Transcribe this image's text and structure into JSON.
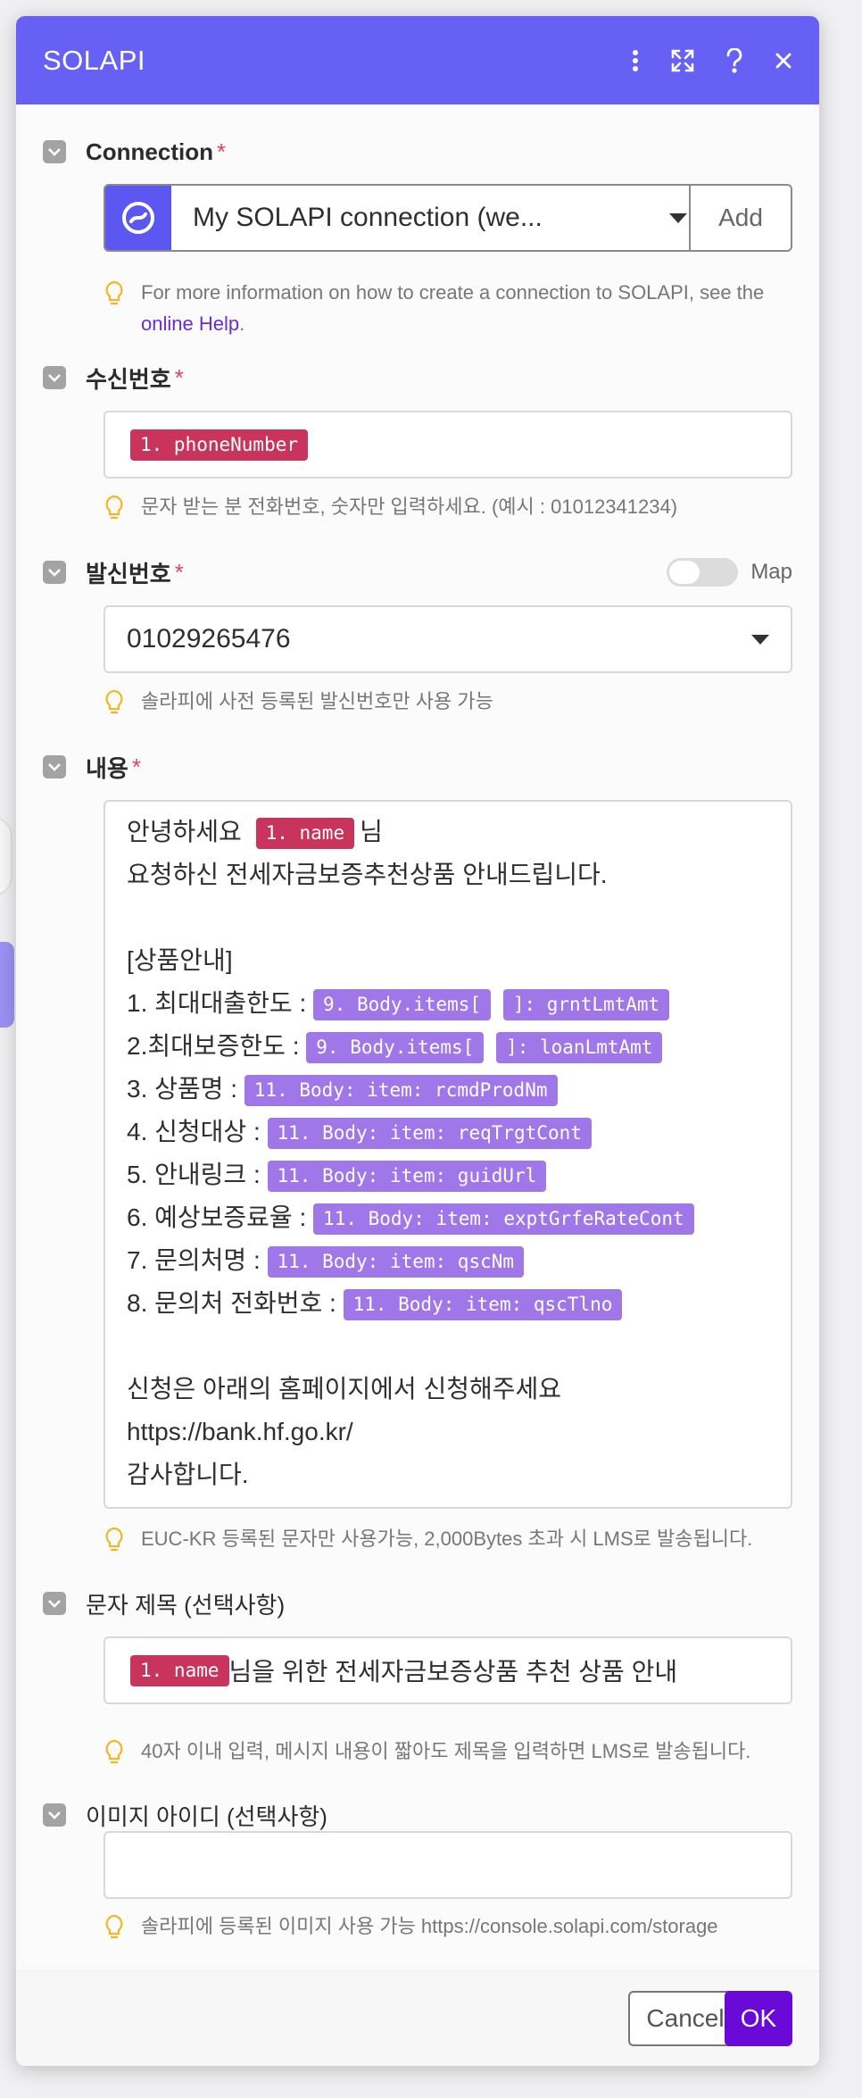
{
  "header": {
    "title": "SOLAPI"
  },
  "connection": {
    "label": "Connection",
    "required": "*",
    "selected": "My SOLAPI connection (we...",
    "add_label": "Add",
    "hint_prefix": "For more information on how to create a connection to SOLAPI, see the ",
    "hint_link": "online Help",
    "hint_suffix": "."
  },
  "recipient": {
    "label": "수신번호",
    "required": "*",
    "tag": "1. phoneNumber",
    "hint": "문자 받는 분 전화번호, 숫자만 입력하세요. (예시 : 01012341234)"
  },
  "sender": {
    "label": "발신번호",
    "required": "*",
    "map_label": "Map",
    "selected": "01029265476",
    "hint": "솔라피에 사전 등록된 발신번호만 사용 가능"
  },
  "content": {
    "label": "내용",
    "required": "*",
    "line1_text": "안녕하세요",
    "line1_tag": "1. name",
    "line1_suffix": "님",
    "line2": "요청하신 전세자금보증추천상품 안내드립니다.",
    "line3": "[상품안내]",
    "item1_label": " 1. 최대대출한도 :",
    "item1_tag_a": "9. Body.items[",
    "item1_tag_b": "]: grntLmtAmt",
    "item2_label": " 2.최대보증한도 :",
    "item2_tag_a": "9. Body.items[",
    "item2_tag_b": "]: loanLmtAmt",
    "item3_label": " 3. 상품명 :",
    "item3_tag": "11. Body: item: rcmdProdNm",
    "item4_label": " 4. 신청대상 :",
    "item4_tag": "11. Body: item: reqTrgtCont",
    "item5_label": " 5. 안내링크 :",
    "item5_tag": "11. Body: item: guidUrl",
    "item6_label": " 6. 예상보증료율 :",
    "item6_tag": "11. Body: item: exptGrfeRateCont",
    "item7_label": " 7. 문의처명 :",
    "item7_tag": "11. Body: item: qscNm",
    "item8_label": " 8. 문의처 전화번호 :",
    "item8_tag": "11. Body: item: qscTlno",
    "closing1": "신청은 아래의 홈페이지에서 신청해주세요",
    "closing2": "https://bank.hf.go.kr/",
    "closing3": "감사합니다.",
    "hint": "EUC-KR 등록된 문자만 사용가능, 2,000Bytes 초과 시 LMS로 발송됩니다."
  },
  "subject": {
    "label": "문자 제목 (선택사항)",
    "tag": "1. name",
    "text": "님을 위한 전세자금보증상품 추천 상품 안내",
    "hint": "40자 이내 입력, 메시지 내용이 짧아도 제목을 입력하면 LMS로 발송됩니다."
  },
  "image_id": {
    "label": "이미지 아이디 (선택사항)",
    "value": "",
    "hint": "솔라피에 등록된 이미지 사용 가능 https://console.solapi.com/storage"
  },
  "footer": {
    "cancel_label": "Cancel",
    "ok_label": "OK"
  },
  "colors": {
    "header": "#6660f5",
    "tag_red": "#c8345c",
    "tag_purple": "#a077e8",
    "ok_button": "#6a0ad8",
    "required": "#e0445a"
  }
}
